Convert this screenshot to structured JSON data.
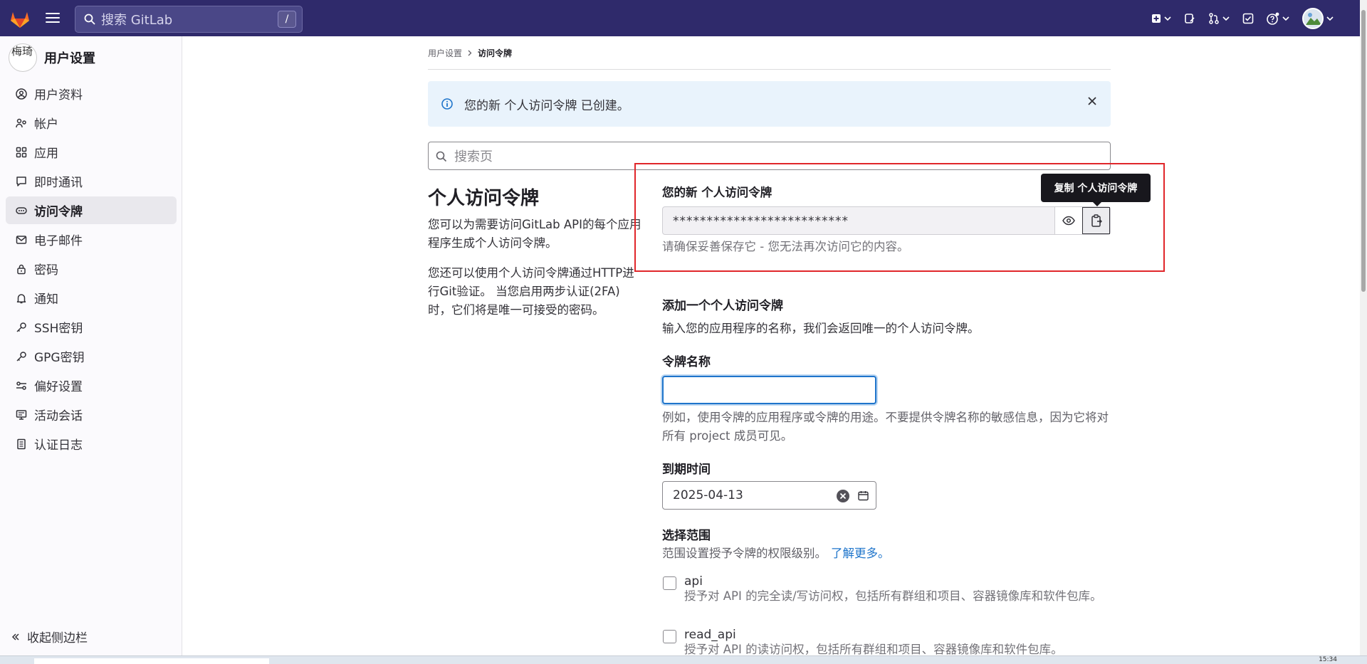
{
  "topbar": {
    "search_placeholder": "搜索 GitLab",
    "search_shortcut": "/"
  },
  "sidebar": {
    "avatar_text": "梅琦",
    "title": "用户设置",
    "items": [
      {
        "label": "用户资料",
        "icon": "profile-icon"
      },
      {
        "label": "帐户",
        "icon": "account-icon"
      },
      {
        "label": "应用",
        "icon": "applications-icon"
      },
      {
        "label": "即时通讯",
        "icon": "chat-icon"
      },
      {
        "label": "访问令牌",
        "icon": "token-icon",
        "active": true
      },
      {
        "label": "电子邮件",
        "icon": "mail-icon"
      },
      {
        "label": "密码",
        "icon": "lock-icon"
      },
      {
        "label": "通知",
        "icon": "notifications-icon"
      },
      {
        "label": "SSH密钥",
        "icon": "key-icon"
      },
      {
        "label": "GPG密钥",
        "icon": "key-icon"
      },
      {
        "label": "偏好设置",
        "icon": "preferences-icon"
      },
      {
        "label": "活动会话",
        "icon": "monitor-icon"
      },
      {
        "label": "认证日志",
        "icon": "log-icon"
      }
    ],
    "collapse_label": "收起侧边栏"
  },
  "breadcrumb": {
    "parent": "用户设置",
    "current": "访问令牌"
  },
  "alert": {
    "message": "您的新 个人访问令牌 已创建。"
  },
  "page_search": {
    "placeholder": "搜索页"
  },
  "intro": {
    "title": "个人访问令牌",
    "para1": "您可以为需要访问GitLab API的每个应用程序生成个人访问令牌。",
    "para2": "您还可以使用个人访问令牌通过HTTP进行Git验证。 当您启用两步认证(2FA)时，它们将是唯一可接受的密码。"
  },
  "new_token": {
    "label": "您的新 个人访问令牌",
    "masked_value": "**************************",
    "hint": "请确保妥善保存它 - 您无法再次访问它的内容。",
    "copy_tooltip": "复制 个人访问令牌"
  },
  "add_token": {
    "title": "添加一个个人访问令牌",
    "description": "输入您的应用程序的名称，我们会返回唯一的个人访问令牌。",
    "name_label": "令牌名称",
    "name_value": "",
    "name_help": "例如，使用令牌的应用程序或令牌的用途。不要提供令牌名称的敏感信息，因为它将对所有 project 成员可见。",
    "expiration_label": "到期时间",
    "expiration_value": "2025-04-13",
    "scopes_label": "选择范围",
    "scopes_desc": "范围设置授予令牌的权限级别。",
    "learn_more": "了解更多。",
    "scopes": [
      {
        "name": "api",
        "desc": "授予对 API 的完全读/写访问权，包括所有群组和项目、容器镜像库和软件包库。"
      },
      {
        "name": "read_api",
        "desc": "授予对 API 的读访问权，包括所有群组和项目、容器镜像库和软件包库。"
      }
    ]
  },
  "taskbar": {
    "clock": "15:34"
  },
  "colors": {
    "topbar": "#2f2a6b",
    "accent": "#1f75cb",
    "highlight": "#e0262a"
  }
}
